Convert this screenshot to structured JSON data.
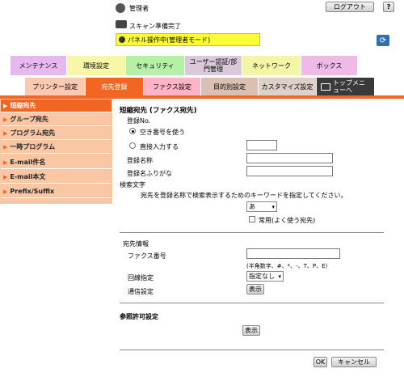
{
  "header": {
    "user_label": "管理者",
    "logout": "ログアウト",
    "help": "?",
    "status": "スキャン準備完了",
    "mode": "パネル操作中(管理者モード)"
  },
  "tabs": [
    "メンテナンス",
    "環境設定",
    "セキュリティ",
    "ユーザー認証/部門管理",
    "ネットワーク",
    "ボックス"
  ],
  "subtabs": [
    "プリンター設定",
    "宛先登録",
    "ファクス設定",
    "目的別設定",
    "カスタマイズ設定",
    "トップメニューへ"
  ],
  "sidebar": [
    "短縮宛先",
    "グループ宛先",
    "プログラム宛先",
    "一時プログラム",
    "E-mail件名",
    "E-mail本文",
    "Prefix/Suffix"
  ],
  "form": {
    "title": "短縮宛先 (ファクス宛先)",
    "reg_no": "登録No.",
    "radio_auto": "空き番号を使う",
    "radio_manual": "直接入力する",
    "name": "登録名称",
    "furigana": "登録名ふりがな",
    "search_char": "検索文字",
    "search_desc": "宛先を登録名称で検索表示するためのキーワードを指定してください。",
    "search_value": "あ",
    "common": "常用(よく使う宛先)",
    "dest_info": "宛先情報",
    "fax_no": "ファクス番号",
    "fax_hint": "(半角数字、#、*、-、T、P、E)",
    "line": "回線指定",
    "line_value": "指定なし",
    "comm": "通信設定",
    "show": "表示",
    "ref_title": "参照許可設定",
    "show2": "表示",
    "ok": "OK",
    "cancel": "キャンセル"
  },
  "colors": {
    "tab_maint": "#e7b8f0",
    "tab_env": "#f7f7a8",
    "tab_sec": "#b5f0a8",
    "tab_user": "#d9c9d9",
    "tab_net": "#f5f5a8",
    "tab_box": "#f0b9e8",
    "sub_printer": "#f9c9b2",
    "sub_dest": "#f26522",
    "sub_fax": "#ffb3c8",
    "sub_purpose": "#d9c0b3",
    "sub_custom": "#ddd0c8",
    "sub_top": "#3a3a3a",
    "sidebar_active": "#f26522",
    "sidebar": "#f9c7a4"
  }
}
